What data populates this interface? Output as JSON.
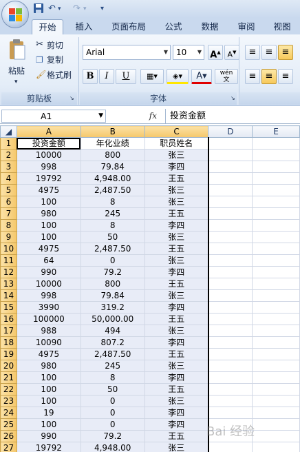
{
  "quick_access": {
    "undo": "↶",
    "redo": "↷",
    "more": "▾"
  },
  "tabs": [
    "开始",
    "插入",
    "页面布局",
    "公式",
    "数据",
    "审阅",
    "视图"
  ],
  "clipboard": {
    "paste": "粘贴",
    "cut": "剪切",
    "copy": "复制",
    "format_painter": "格式刷",
    "group": "剪贴板"
  },
  "font": {
    "name": "Arial",
    "size": "10",
    "bold": "B",
    "italic": "I",
    "underline": "U",
    "wen": "wén",
    "group": "字体"
  },
  "formula_bar": {
    "name_box": "A1",
    "fx": "fx",
    "value": "投资金额"
  },
  "columns": [
    "A",
    "B",
    "C",
    "D",
    "E"
  ],
  "rows": [
    [
      "1",
      "投资金额",
      "年化业绩",
      "职员姓名"
    ],
    [
      "2",
      "10000",
      "800",
      "张三"
    ],
    [
      "3",
      "998",
      "79.84",
      "李四"
    ],
    [
      "4",
      "19792",
      "4,948.00",
      "王五"
    ],
    [
      "5",
      "4975",
      "2,487.50",
      "张三"
    ],
    [
      "6",
      "100",
      "8",
      "张三"
    ],
    [
      "7",
      "980",
      "245",
      "王五"
    ],
    [
      "8",
      "100",
      "8",
      "李四"
    ],
    [
      "9",
      "100",
      "50",
      "张三"
    ],
    [
      "10",
      "4975",
      "2,487.50",
      "王五"
    ],
    [
      "11",
      "64",
      "0",
      "张三"
    ],
    [
      "12",
      "990",
      "79.2",
      "李四"
    ],
    [
      "13",
      "10000",
      "800",
      "王五"
    ],
    [
      "14",
      "998",
      "79.84",
      "张三"
    ],
    [
      "15",
      "3990",
      "319.2",
      "李四"
    ],
    [
      "16",
      "100000",
      "50,000.00",
      "王五"
    ],
    [
      "17",
      "988",
      "494",
      "张三"
    ],
    [
      "18",
      "10090",
      "807.2",
      "李四"
    ],
    [
      "19",
      "4975",
      "2,487.50",
      "王五"
    ],
    [
      "20",
      "980",
      "245",
      "张三"
    ],
    [
      "21",
      "100",
      "8",
      "李四"
    ],
    [
      "22",
      "100",
      "50",
      "王五"
    ],
    [
      "23",
      "100",
      "0",
      "张三"
    ],
    [
      "24",
      "19",
      "0",
      "李四"
    ],
    [
      "25",
      "100",
      "0",
      "李四"
    ],
    [
      "26",
      "990",
      "79.2",
      "王五"
    ],
    [
      "27",
      "19792",
      "4,948.00",
      "张三"
    ]
  ],
  "watermark": "Bai 经验",
  "colors": {
    "selection": "#e8ecf7",
    "header_selected": "#f5c76a",
    "ribbon": "#dce7f5"
  }
}
